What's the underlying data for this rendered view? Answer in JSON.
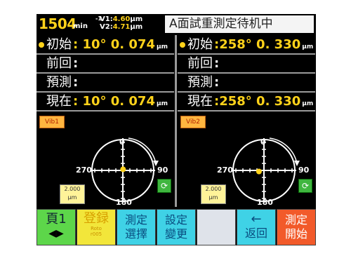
{
  "header": {
    "rpm": "1504",
    "rpm_unit": "min",
    "rpm_sup": "-1",
    "v1_label": "V1:",
    "v1_value": "4.60",
    "v1_unit": "μm",
    "v2_label": "V2:",
    "v2_value": "4.71",
    "v2_unit": "μm",
    "status": "A面試重測定待机中"
  },
  "left": {
    "rows": [
      {
        "label": "初始",
        "value": ": 10° 0. 074",
        "unit": "μm"
      },
      {
        "label": "前回",
        "value": ":",
        "unit": ""
      },
      {
        "label": "預測",
        "value": ":",
        "unit": ""
      },
      {
        "label": "現在",
        "value": ": 10° 0. 074",
        "unit": "μm"
      }
    ],
    "vib_label": "Vib1",
    "scale_value": "2.000",
    "scale_unit": "μm",
    "angles": {
      "top": "0",
      "right": "90",
      "bottom": "180",
      "left": "270"
    },
    "point_angle_deg": 10,
    "point_magnitude": 0.074
  },
  "right": {
    "rows": [
      {
        "label": "初始",
        "value": ":258° 0. 330",
        "unit": "μm"
      },
      {
        "label": "前回",
        "value": ":",
        "unit": ""
      },
      {
        "label": "預測",
        "value": ":",
        "unit": ""
      },
      {
        "label": "現在",
        "value": ":258° 0. 330",
        "unit": "μm"
      }
    ],
    "vib_label": "Vib2",
    "scale_value": "2.000",
    "scale_unit": "μm",
    "angles": {
      "top": "0",
      "right": "90",
      "bottom": "180",
      "left": "270"
    },
    "point_angle_deg": 258,
    "point_magnitude": 0.33
  },
  "footer": {
    "page_label": "頁1",
    "page_arrows": "◀▶",
    "register_label": "登録",
    "register_sub": "Roto\nr005",
    "measure_select_line1": "測定",
    "measure_select_line2": "選擇",
    "settings_line1": "設定",
    "settings_line2": "變更",
    "back_arrow": "←",
    "back_label": "返回",
    "start_line1": "測定",
    "start_line2": "開始"
  },
  "colors": {
    "background": "#000000",
    "value_yellow": "#ffd21a",
    "page_green": "#5dd64a",
    "register_yellow": "#f2e63a",
    "cyan": "#3fd2e6",
    "start_red": "#f25a2a"
  }
}
